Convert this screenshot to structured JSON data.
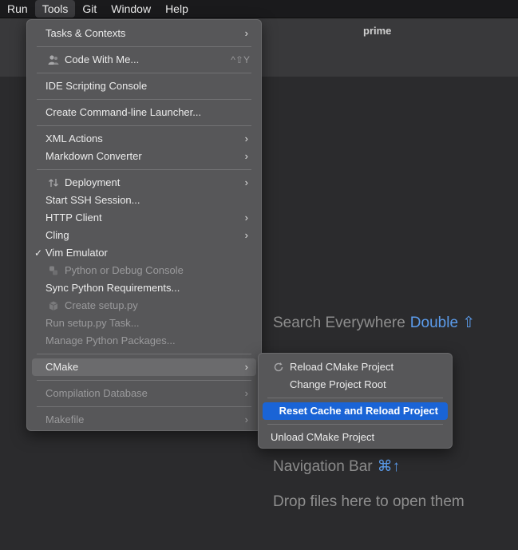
{
  "menubar": {
    "items": [
      {
        "label": "Run"
      },
      {
        "label": "Tools"
      },
      {
        "label": "Git"
      },
      {
        "label": "Window"
      },
      {
        "label": "Help"
      }
    ]
  },
  "titlebar": {
    "project": "prime"
  },
  "editor": {
    "hints": [
      {
        "text": "Search Everywhere",
        "shortcut": "Double ⇧"
      },
      {
        "text": "Navigation Bar",
        "shortcut": "⌘↑"
      },
      {
        "text": "Drop files here to open them",
        "shortcut": ""
      }
    ]
  },
  "tools_menu": {
    "items": [
      {
        "label": "Tasks & Contexts",
        "submenu": true
      },
      {
        "label": "Code With Me...",
        "shortcut": "^⇧Y",
        "icon": "user-icon"
      },
      {
        "label": "IDE Scripting Console"
      },
      {
        "label": "Create Command-line Launcher..."
      },
      {
        "label": "XML Actions",
        "submenu": true
      },
      {
        "label": "Markdown Converter",
        "submenu": true
      },
      {
        "label": "Deployment",
        "submenu": true,
        "icon": "deploy-icon"
      },
      {
        "label": "Start SSH Session..."
      },
      {
        "label": "HTTP Client",
        "submenu": true
      },
      {
        "label": "Cling",
        "submenu": true
      },
      {
        "label": "Vim Emulator",
        "checked": true
      },
      {
        "label": "Python or Debug Console",
        "disabled": true,
        "icon": "python-icon"
      },
      {
        "label": "Sync Python Requirements..."
      },
      {
        "label": "Create setup.py",
        "disabled": true,
        "icon": "package-icon"
      },
      {
        "label": "Run setup.py Task...",
        "disabled": true
      },
      {
        "label": "Manage Python Packages...",
        "disabled": true
      },
      {
        "label": "CMake",
        "submenu": true
      },
      {
        "label": "Compilation Database",
        "submenu": true,
        "disabled": true
      },
      {
        "label": "Makefile",
        "submenu": true,
        "disabled": true
      }
    ]
  },
  "cmake_menu": {
    "items": [
      {
        "label": "Reload CMake Project",
        "icon": "reload-icon"
      },
      {
        "label": "Change Project Root"
      },
      {
        "label": "Reset Cache and Reload Project",
        "icon": "reset-icon"
      },
      {
        "label": "Unload CMake Project"
      }
    ]
  },
  "glyphs": {
    "chevron": "›",
    "check": "✓"
  },
  "colors": {
    "accent": "#1a64d6",
    "shortcut": "#5c9ded",
    "background": "#2b2b2d"
  }
}
